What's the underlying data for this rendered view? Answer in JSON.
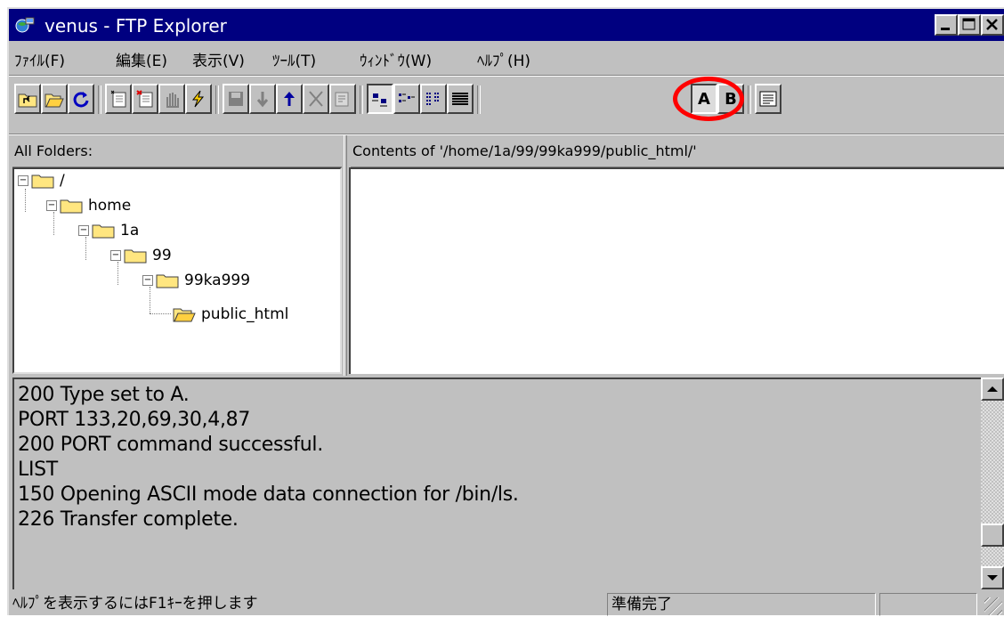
{
  "window": {
    "title": "venus - FTP Explorer",
    "controls": [
      "minimize",
      "maximize",
      "close"
    ]
  },
  "menu": {
    "items": [
      "ﾌｧｲﾙ(F)",
      "編集(E)",
      "表示(V)",
      "ﾂｰﾙ(T)",
      "ｳｨﾝﾄﾞｳ(W)",
      "ﾍﾙﾌﾟ(H)"
    ]
  },
  "toolbar": {
    "transfer_mode_ascii_label": "A",
    "transfer_mode_binary_label": "B",
    "highlighted_button": "transfer-mode-ascii",
    "highlight_color": "#ff0000"
  },
  "folders_pane": {
    "header": "All Folders:",
    "tree": [
      {
        "label": "/",
        "depth": 0
      },
      {
        "label": "home",
        "depth": 1
      },
      {
        "label": "1a",
        "depth": 2
      },
      {
        "label": "99",
        "depth": 3
      },
      {
        "label": "99ka999",
        "depth": 4
      },
      {
        "label": "public_html",
        "depth": 5
      }
    ]
  },
  "contents_pane": {
    "header": "Contents of '/home/1a/99/99ka999/public_html/'"
  },
  "log": {
    "lines": [
      "200 Type set to A.",
      "PORT 133,20,69,30,4,87",
      "200 PORT command successful.",
      "LIST",
      "150 Opening ASCII mode data connection for /bin/ls.",
      "226 Transfer complete."
    ]
  },
  "statusbar": {
    "help_text": "ﾍﾙﾌﾟを表示するにはF1ｷｰを押します",
    "state": "準備完了"
  },
  "colors": {
    "titlebar": "#000080",
    "face": "#c0c0c0",
    "folder": "#ffe680"
  }
}
